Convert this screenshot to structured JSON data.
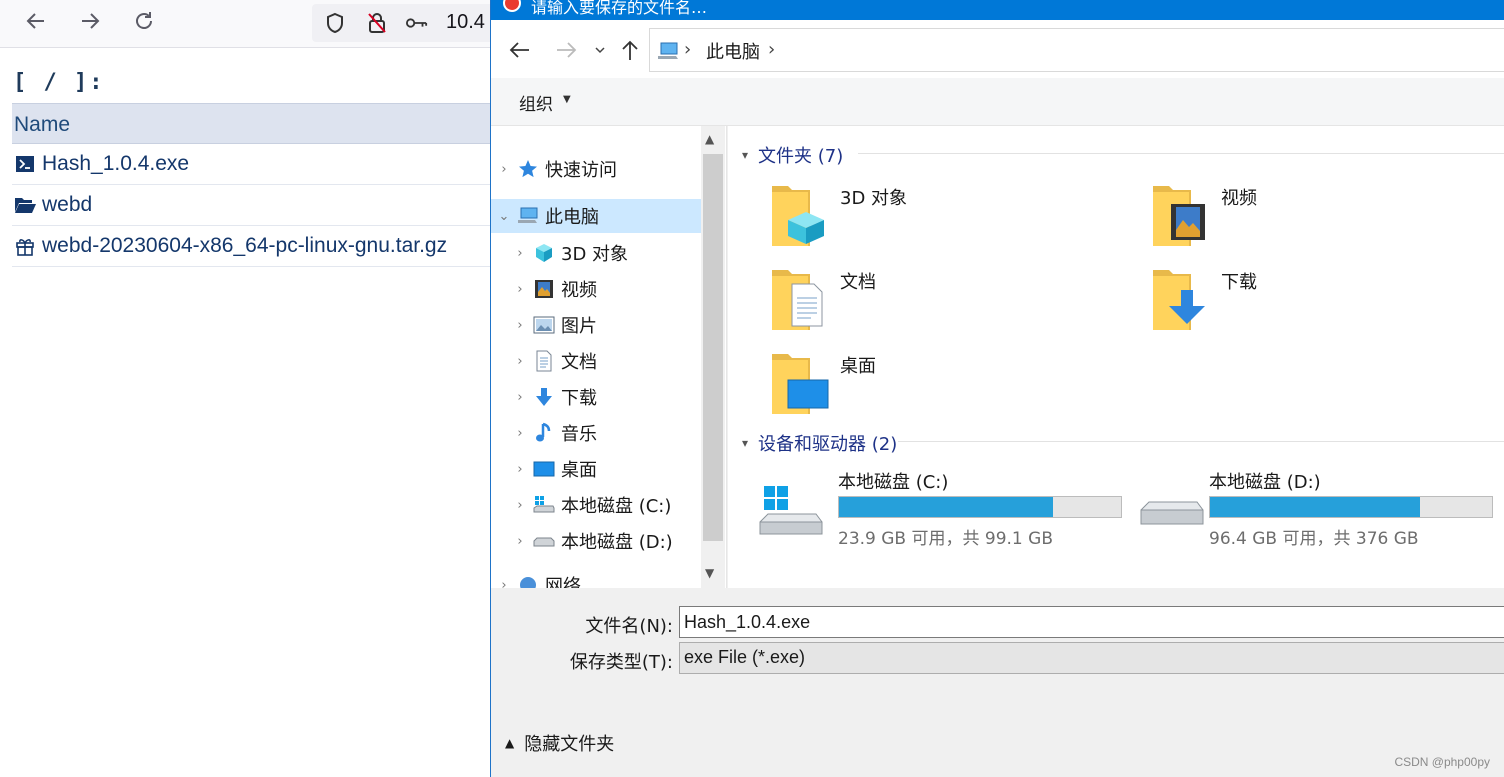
{
  "browser": {
    "url_partial": "10.4",
    "directory_title": "[ / ]:",
    "column_header": "Name",
    "files": [
      {
        "name": "Hash_1.0.4.exe",
        "icon": "terminal-icon"
      },
      {
        "name": "webd",
        "icon": "folder-open-icon"
      },
      {
        "name": "webd-20230604-x86_64-pc-linux-gnu.tar.gz",
        "icon": "gift-archive-icon"
      }
    ]
  },
  "dialog": {
    "title": "请输入要保存的文件名…",
    "address": {
      "crumb": "此电脑"
    },
    "command_bar": {
      "organize": "组织"
    },
    "nav": {
      "quick_access": "快速访问",
      "this_pc": "此电脑",
      "items": [
        "3D 对象",
        "视频",
        "图片",
        "文档",
        "下载",
        "音乐",
        "桌面",
        "本地磁盘 (C:)",
        "本地磁盘 (D:)"
      ],
      "network": "网络"
    },
    "folders_group": {
      "title": "文件夹 (7)",
      "items": [
        "3D 对象",
        "视频",
        "文档",
        "下载",
        "桌面"
      ]
    },
    "drives_group": {
      "title": "设备和驱动器 (2)",
      "drives": [
        {
          "name": "本地磁盘 (C:)",
          "free": "23.9 GB 可用，共 99.1 GB",
          "used_fraction": 0.759
        },
        {
          "name": "本地磁盘 (D:)",
          "free": "96.4 GB 可用，共 376 GB",
          "used_fraction": 0.744
        }
      ]
    },
    "filename_label": "文件名(N):",
    "filename_value": "Hash_1.0.4.exe",
    "filetype_label": "保存类型(T):",
    "filetype_value": "exe File (*.exe)",
    "hide_folders": "隐藏文件夹"
  },
  "watermark": "CSDN @php00py",
  "colors": {
    "accent": "#0078d7",
    "drive_fill": "#26a0da",
    "selection": "#cce8ff"
  }
}
